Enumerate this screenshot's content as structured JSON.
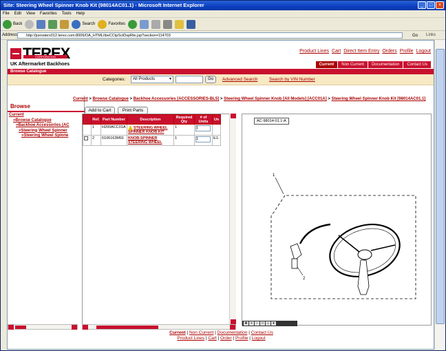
{
  "window": {
    "title": "Site: Steering Wheel Spinner Knob Kit (98014AC01.1) - Microsoft Internet Explorer"
  },
  "menu": [
    "File",
    "Edit",
    "View",
    "Favorites",
    "Tools",
    "Help"
  ],
  "toolbar": {
    "back": "Back",
    "search": "Search",
    "favorites": "Favorites"
  },
  "address": {
    "label": "Address",
    "url": "http://juxnsterx012.terex.com:8006/OA_HTML/ibeCCtpSctDspRte.jsp?section=114703",
    "go": "Go",
    "links": "Links"
  },
  "header": {
    "logo_text": "TEREX",
    "corporation": "CORPORATION",
    "site_name": "UK Aftermarket Backhoes",
    "top_links": [
      "Product Lines",
      "Cart",
      "Direct Item Entry",
      "Orders",
      "Profile",
      "Logout"
    ],
    "tabs": [
      "Current",
      "Non Current",
      "Documentation",
      "Contact Us"
    ]
  },
  "section_bar": "Browse Catalogue",
  "search": {
    "categories_label": "Categories:",
    "selected": "All Products",
    "go": "Go",
    "advanced": "Advanced Search",
    "vin": "Search by VIN Number"
  },
  "browse": {
    "title": "Browse",
    "tree": [
      "Current",
      "»Browse Catalogue",
      "»Backhoe Accessories (AC",
      "»Steering Wheel Spinner",
      "»Steering Wheel Spinne"
    ]
  },
  "breadcrumb": {
    "items": [
      "Current",
      "Browse Catalogue",
      "Backhoe Accessories [ACCESSORIES-BL5]",
      "Steering Wheel Spinner Knob [All Models] [ACC01A]",
      "Steering Wheel Spinner Knob Kit [98014AC01.1]"
    ]
  },
  "buttons": {
    "add_to_cart": "Add to Cart",
    "print_parts": "Print Parts"
  },
  "parts_table": {
    "headers": [
      "Ref.",
      "Part Number",
      "Description",
      "Required Qty",
      "# of Units",
      "Un"
    ],
    "rows": [
      {
        "ref": "1",
        "part": "H200ACC01A",
        "desc": "STEERING WHEEL SPINNER KNOB KIT",
        "qty": "1",
        "units": "1",
        "un": ""
      },
      {
        "ref": "2",
        "part": "6106163M91",
        "desc": "KNOB-SPINNER STEERING WHEEL",
        "qty": "1",
        "units": "1",
        "un": "E1-"
      }
    ]
  },
  "diagram": {
    "label": "AC-98014-01.1-A",
    "callouts": [
      "1",
      "2"
    ]
  },
  "footer": {
    "line1": [
      "Current",
      "Non Current",
      "Documentation",
      "Contact Us"
    ],
    "line2": [
      "Product Lines",
      "Cart",
      "Order",
      "Profile",
      "Logout"
    ]
  }
}
